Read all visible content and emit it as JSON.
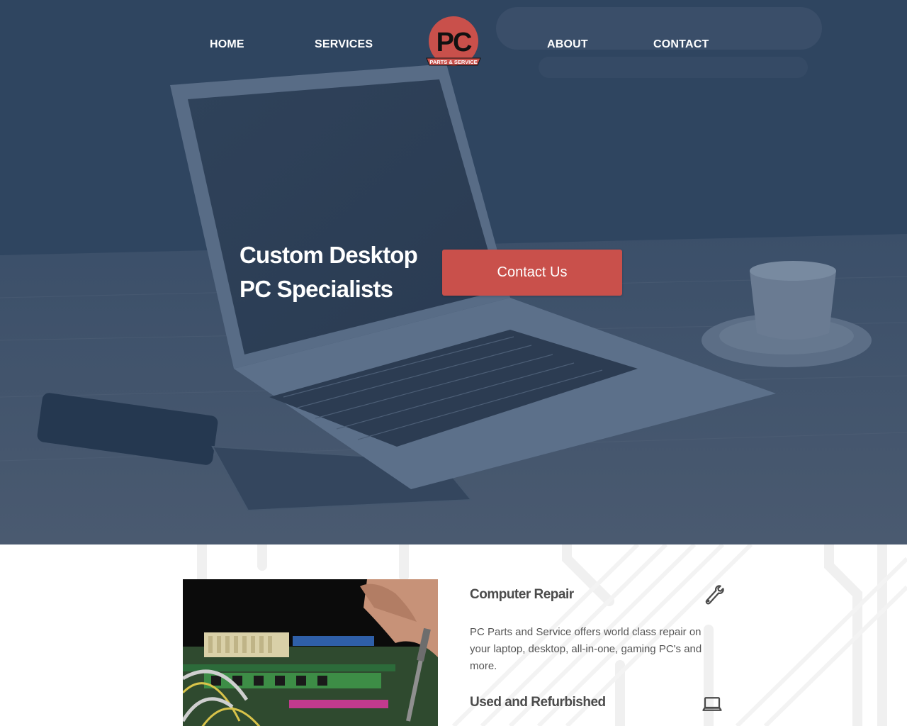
{
  "nav": {
    "items": [
      {
        "label": "HOME"
      },
      {
        "label": "SERVICES"
      },
      {
        "label": "ABOUT"
      },
      {
        "label": "CONTACT"
      }
    ],
    "logo": {
      "main_text": "PC",
      "sub_text": "PARTS & SERVICE"
    }
  },
  "hero": {
    "title_line1": "Custom Desktop",
    "title_line2": "PC Specialists",
    "cta_label": "Contact Us"
  },
  "services": [
    {
      "title": "Computer Repair",
      "icon": "wrench-icon",
      "description": "PC Parts and Service offers world class repair on your laptop, desktop, all-in-one, gaming PC's and more."
    },
    {
      "title": "Used and Refurbished",
      "icon": "laptop-icon"
    }
  ],
  "colors": {
    "hero_overlay": "#324966",
    "accent": "#c9504b",
    "nav_text": "#ffffff",
    "service_text": "#4b4b4b"
  }
}
